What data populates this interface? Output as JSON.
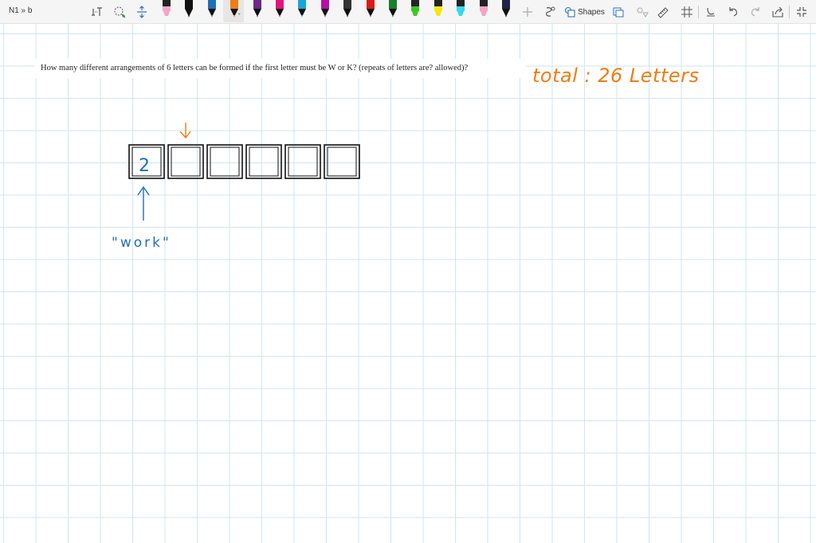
{
  "page": {
    "title": "N1 » b"
  },
  "toolbar": {
    "tools": [
      "type-text-icon",
      "lasso-select-icon",
      "add-space-icon"
    ],
    "pens": [
      {
        "name": "highlighter-pink",
        "color": "#f4a6c8"
      },
      {
        "name": "pen-black-1",
        "color": "#111111"
      },
      {
        "name": "pen-blue",
        "color": "#1f6fb5"
      },
      {
        "name": "pen-orange-selected",
        "color": "#ef7d12"
      },
      {
        "name": "pen-purple",
        "color": "#6a2a86"
      },
      {
        "name": "pen-magenta",
        "color": "#e4137f"
      },
      {
        "name": "pen-cyan",
        "color": "#17a7d8"
      },
      {
        "name": "pen-violet",
        "color": "#b50fa8"
      },
      {
        "name": "pen-dark",
        "color": "#333333"
      },
      {
        "name": "pen-red",
        "color": "#d91b1b"
      },
      {
        "name": "pen-green",
        "color": "#1a7e2c"
      },
      {
        "name": "highlighter-green",
        "color": "#3ec61e"
      },
      {
        "name": "highlighter-yellow",
        "color": "#f5e70a"
      },
      {
        "name": "highlighter-cyan",
        "color": "#32d7f0"
      },
      {
        "name": "highlighter-pink-2",
        "color": "#f7a1c4"
      },
      {
        "name": "pen-navy",
        "color": "#222244"
      }
    ],
    "shapes_label": "Shapes"
  },
  "note": {
    "question": "How many different arrangements of 6 letters can be formed if the first letter must be W or K? (repeats of letters are? allowed)?",
    "ink_color": "#ef7d12",
    "ink_blue": "#1f6fb5",
    "total_text": "total : 26 Letters",
    "first_box_value": "2",
    "work_label": "\"work\"",
    "box_count": 6
  },
  "colors": {
    "grid": "#cfe6f3",
    "toolbar_bg": "#f5f5f5"
  }
}
